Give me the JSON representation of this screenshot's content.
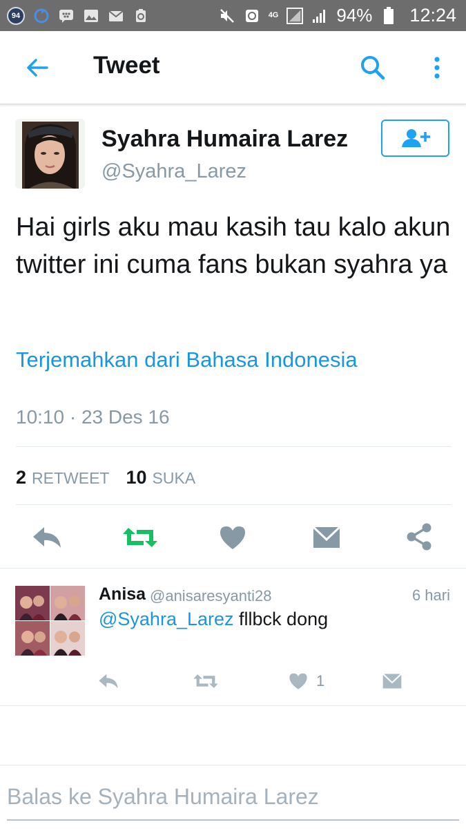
{
  "status_bar": {
    "notification_count": "94",
    "network": "4G",
    "battery": "94%",
    "time": "12:24"
  },
  "app_bar": {
    "title": "Tweet"
  },
  "tweet": {
    "author_name": "Syahra Humaira Larez",
    "author_handle": "@Syahra_Larez",
    "text": "Hai girls aku mau kasih tau kalo akun twitter ini cuma fans bukan syahra ya",
    "translate_link": "Terjemahkan dari Bahasa Indonesia",
    "timestamp": "10:10 · 23 Des 16",
    "retweet_count": "2",
    "retweet_label": "RETWEET",
    "like_count": "10",
    "like_label": "SUKA"
  },
  "reply": {
    "author_name": "Anisa",
    "author_handle": "@anisaresyanti28",
    "time": "6 hari",
    "mention": "@Syahra_Larez",
    "text": "fllbck dong",
    "like_count": "1"
  },
  "reply_box": {
    "placeholder": "Balas ke Syahra Humaira Larez"
  },
  "colors": {
    "accent": "#1da1f2",
    "retweet_green": "#17bf63",
    "icon_gray": "#8899a6",
    "status_bar": "#6d6d6d"
  },
  "icons": [
    "arrow-left-icon",
    "search-icon",
    "more-vertical-icon",
    "follow-user-icon",
    "reply-icon",
    "retweet-icon",
    "heart-icon",
    "message-icon",
    "share-icon"
  ]
}
